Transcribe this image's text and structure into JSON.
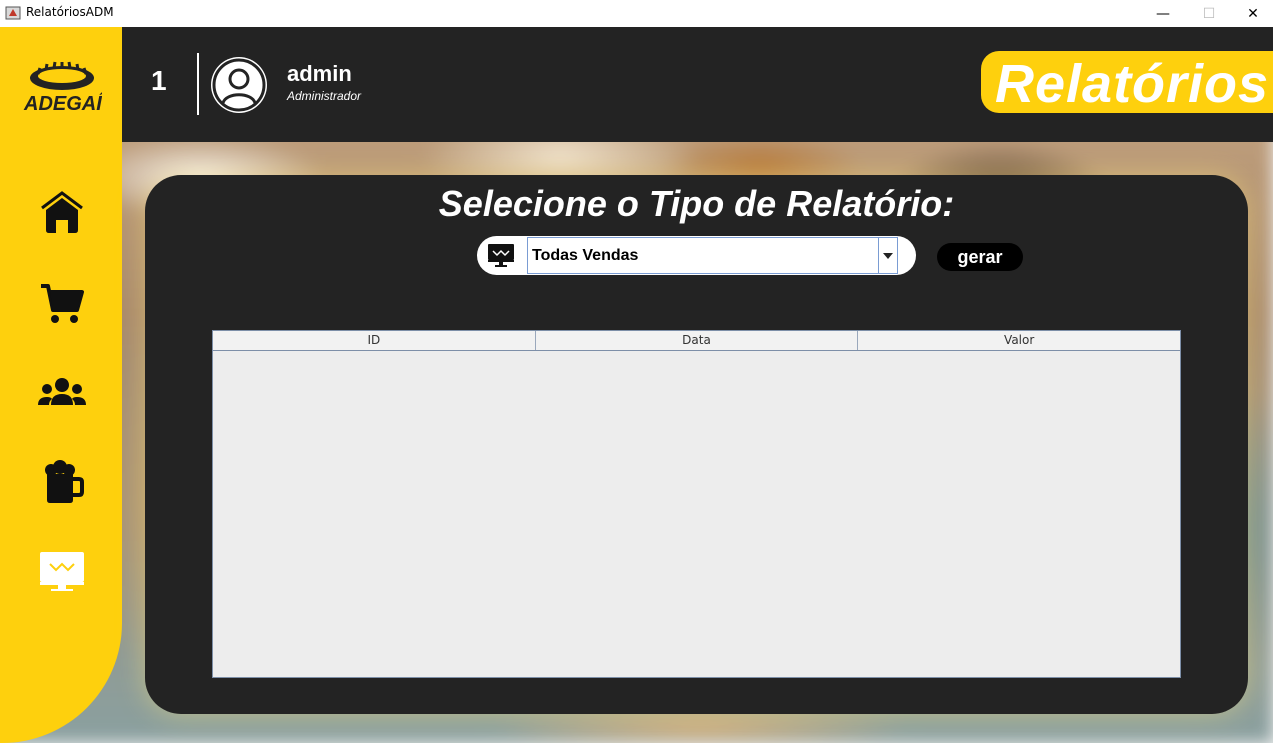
{
  "window": {
    "title": "RelatóriosADM",
    "minimize": "—",
    "maximize": "☐",
    "close": "✕"
  },
  "header": {
    "counter": "1",
    "username": "admin",
    "role": "Administrador",
    "page_title": "Relatórios"
  },
  "sidebar": {
    "logo_text": "ADEGAÍ",
    "items": [
      {
        "name": "home-icon"
      },
      {
        "name": "cart-icon"
      },
      {
        "name": "users-icon"
      },
      {
        "name": "beer-mug-icon"
      },
      {
        "name": "reports-monitor-icon",
        "active": true
      }
    ]
  },
  "main": {
    "heading": "Selecione o Tipo de Relatório:",
    "report_select": {
      "value": "Todas Vendas"
    },
    "generate_button": "gerar",
    "table": {
      "columns": [
        "ID",
        "Data",
        "Valor"
      ],
      "rows": []
    }
  },
  "colors": {
    "accent": "#fed00d",
    "dark": "#232323",
    "table_bg": "#ededed"
  }
}
